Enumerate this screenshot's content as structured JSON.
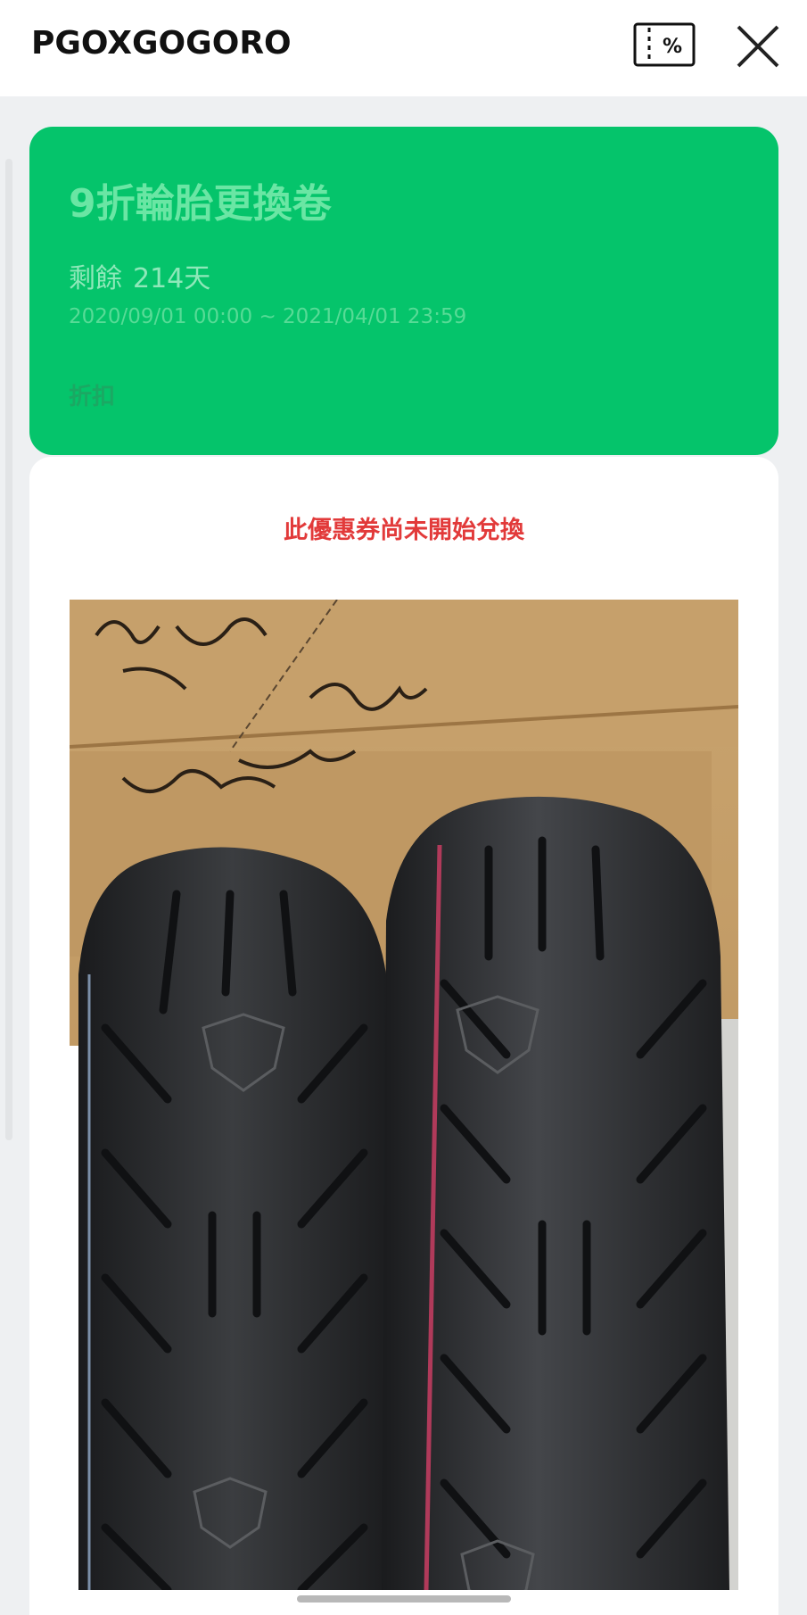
{
  "header": {
    "title": "PGOXGOGORO",
    "coupon_icon": "coupon-percent-icon",
    "close_icon": "close-icon"
  },
  "coupon": {
    "title": "9折輪胎更換卷",
    "remaining_label": "剩餘",
    "remaining_value": "214天",
    "validity": "2020/09/01 00:00 ~ 2021/04/01 23:59",
    "type": "折扣",
    "color": "#05c46b"
  },
  "panel": {
    "status_message": "此優惠券尚未開始兌換",
    "status_color": "#e23a3a",
    "image_description_icon": "tires-photo"
  }
}
